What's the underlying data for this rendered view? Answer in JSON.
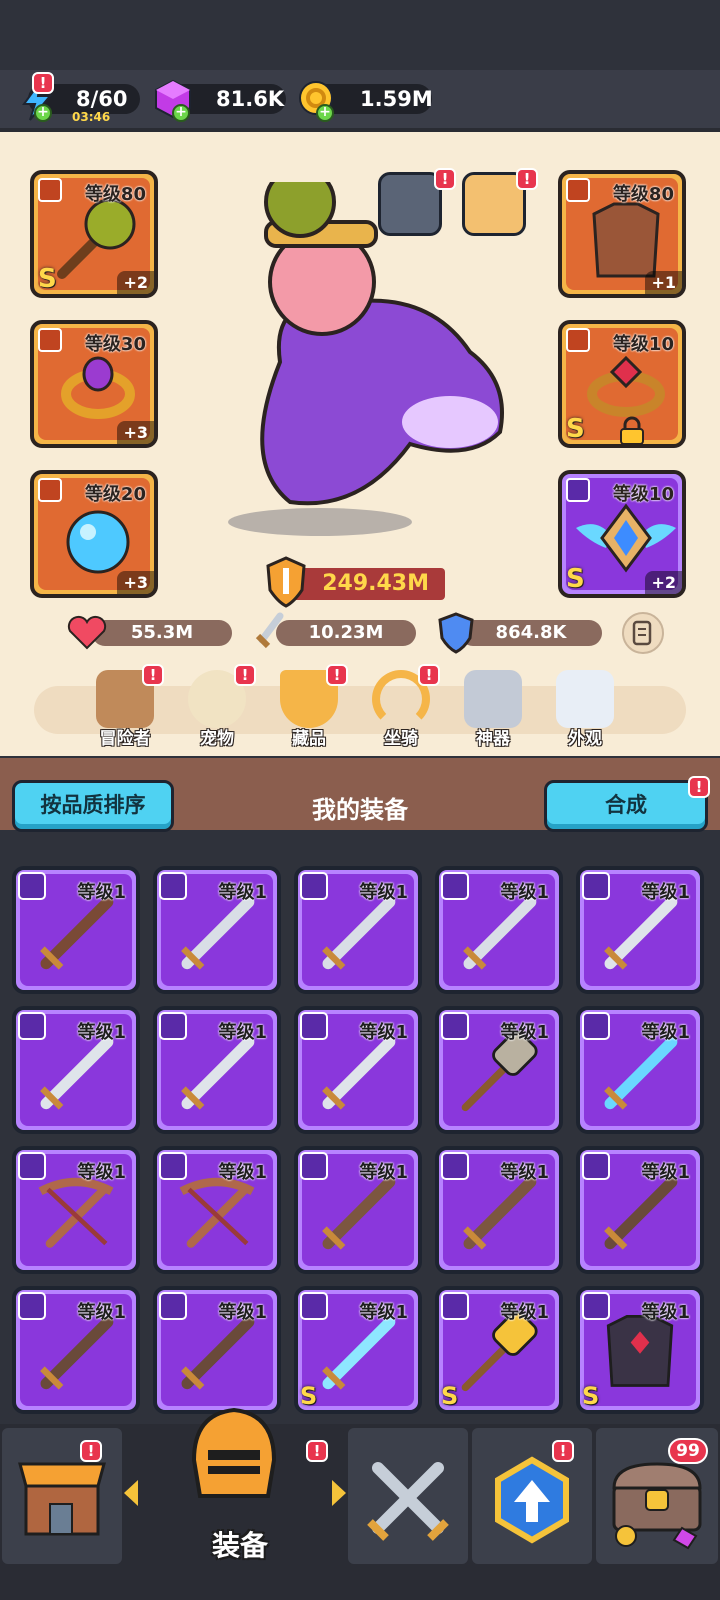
{
  "resources": {
    "energy": {
      "value": "8/60",
      "timer": "03:46"
    },
    "gems": {
      "value": "81.6K"
    },
    "gold": {
      "value": "1.59M"
    }
  },
  "hero": {
    "power": "249.43M",
    "stats": {
      "hp": "55.3M",
      "attack": "10.23M",
      "defense": "864.8K"
    },
    "left_slots": [
      {
        "level": "等级80",
        "plus": "+2",
        "grade": "S"
      },
      {
        "level": "等级30",
        "plus": "+3"
      },
      {
        "level": "等级20",
        "plus": "+3"
      }
    ],
    "right_slots": [
      {
        "level": "等级80",
        "plus": "+1"
      },
      {
        "level": "等级10",
        "grade": "S"
      },
      {
        "level": "等级10",
        "plus": "+2",
        "grade": "S"
      }
    ]
  },
  "features": [
    {
      "label": "冒险者",
      "icon": "capybara-icon"
    },
    {
      "label": "宠物",
      "icon": "egg-icon"
    },
    {
      "label": "藏品",
      "icon": "trophy-icon"
    },
    {
      "label": "坐骑",
      "icon": "horseshoe-icon"
    },
    {
      "label": "神器",
      "icon": "hammer-icon"
    },
    {
      "label": "外观",
      "icon": "outfit-icon"
    }
  ],
  "equipment": {
    "title": "我的装备",
    "sort_label": "按品质排序",
    "merge_label": "合成",
    "items": [
      {
        "level": "等级1",
        "icon": "wooden-sword-icon"
      },
      {
        "level": "等级1",
        "icon": "steel-sword-icon"
      },
      {
        "level": "等级1",
        "icon": "steel-sword-icon"
      },
      {
        "level": "等级1",
        "icon": "steel-sword-icon"
      },
      {
        "level": "等级1",
        "icon": "scimitar-icon"
      },
      {
        "level": "等级1",
        "icon": "scimitar-icon"
      },
      {
        "level": "等级1",
        "icon": "scimitar-icon"
      },
      {
        "level": "等级1",
        "icon": "scimitar-icon"
      },
      {
        "level": "等级1",
        "icon": "mace-icon"
      },
      {
        "level": "等级1",
        "icon": "spear-icon"
      },
      {
        "level": "等级1",
        "icon": "crossbow-icon"
      },
      {
        "level": "等级1",
        "icon": "crossbow-icon"
      },
      {
        "level": "等级1",
        "icon": "staff-icon"
      },
      {
        "level": "等级1",
        "icon": "staff-icon"
      },
      {
        "level": "等级1",
        "icon": "club-icon"
      },
      {
        "level": "等级1",
        "icon": "club-icon"
      },
      {
        "level": "等级1",
        "icon": "club-icon"
      },
      {
        "level": "等级1",
        "icon": "crystal-sword-icon",
        "grade": "S"
      },
      {
        "level": "等级1",
        "icon": "golden-hammer-icon",
        "grade": "S"
      },
      {
        "level": "等级1",
        "icon": "dark-armor-icon",
        "grade": "S"
      }
    ]
  },
  "nav": {
    "active_label": "装备",
    "chest_count": "99"
  },
  "colors": {
    "purple_item": "#8a37dc",
    "orange_slot": "#e06a32",
    "alert_red": "#e8354e",
    "button_cyan": "#4fd2f2"
  }
}
